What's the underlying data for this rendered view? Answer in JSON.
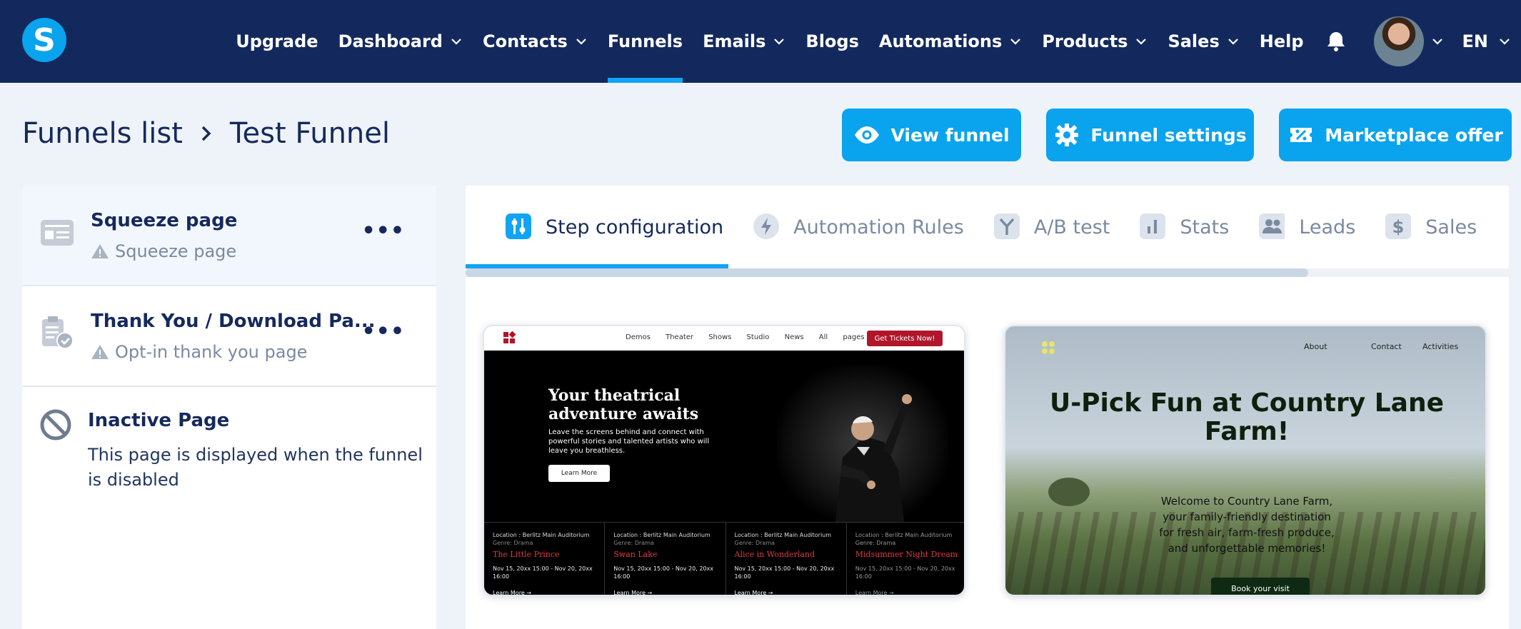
{
  "nav": {
    "logo_letter": "S",
    "items": [
      {
        "label": "Upgrade"
      },
      {
        "label": "Dashboard"
      },
      {
        "label": "Contacts"
      },
      {
        "label": "Funnels"
      },
      {
        "label": "Emails"
      },
      {
        "label": "Blogs"
      },
      {
        "label": "Automations"
      },
      {
        "label": "Products"
      },
      {
        "label": "Sales"
      },
      {
        "label": "Help"
      }
    ],
    "active": "Funnels",
    "language": "EN"
  },
  "breadcrumb": {
    "parent": "Funnels list",
    "current": "Test Funnel"
  },
  "actions": {
    "view_funnel": "View funnel",
    "funnel_settings": "Funnel settings",
    "marketplace_offer": "Marketplace offer"
  },
  "steps": [
    {
      "title": "Squeeze page",
      "subtitle": "Squeeze page",
      "icon": "page-layout-icon"
    },
    {
      "title": "Thank You / Download Pa...",
      "subtitle": "Opt-in thank you page",
      "icon": "clipboard-check-icon"
    }
  ],
  "inactive_page": {
    "title": "Inactive Page",
    "description": "This page is displayed when the funnel is disabled"
  },
  "tabs": [
    {
      "label": "Step configuration",
      "icon": "sliders-icon"
    },
    {
      "label": "Automation Rules",
      "icon": "lightning-icon"
    },
    {
      "label": "A/B test",
      "icon": "split-icon"
    },
    {
      "label": "Stats",
      "icon": "bar-chart-icon"
    },
    {
      "label": "Leads",
      "icon": "users-icon"
    },
    {
      "label": "Sales",
      "icon": "dollar-icon"
    }
  ],
  "templates": {
    "theater": {
      "menu": "Demos Theater Shows Studio News All pages",
      "cta": "Get Tickets Now!",
      "heading": "Your theatrical adventure awaits",
      "text": "Leave the screens behind and connect with powerful stories and talented artists who will leave you breathless.",
      "button": "Learn More",
      "shows": [
        {
          "location": "Location : Berlitz Main Auditorium",
          "genre": "Genre: Drama",
          "title": "The Little Prince",
          "dates": "Nov 15, 20xx 15:00 - Nov 20, 20xx 16:00",
          "link": "Learn More →"
        },
        {
          "location": "Location : Berlitz Main Auditorium",
          "genre": "Genre: Drama",
          "title": "Swan Lake",
          "dates": "Nov 15, 20xx 15:00 - Nov 20, 20xx 16:00",
          "link": "Learn More →"
        },
        {
          "location": "Location : Berlitz Main Auditorium",
          "genre": "Genre: Drama",
          "title": "Alice in Wonderland",
          "dates": "Nov 15, 20xx 15:00 - Nov 20, 20xx 16:00",
          "link": "Learn More →"
        },
        {
          "location": "Location : Berlitz Main Auditorium",
          "genre": "Genre: Drama",
          "title": "Midsummer Night Dream",
          "dates": "Nov 15, 20xx 15:00 - Nov 20, 20xx 16:00",
          "link": "Learn More →"
        }
      ]
    },
    "farm": {
      "menu": [
        "About",
        "Contact",
        "Activities"
      ],
      "heading": "U-Pick Fun at Country Lane Farm!",
      "text": "Welcome to Country Lane Farm, your family-friendly destination for fresh air, farm-fresh produce, and unforgettable memories!",
      "button": "Book your visit"
    }
  },
  "colors": {
    "nav_bg": "#13295e",
    "accent": "#0aa3ee",
    "text_dark": "#15295c",
    "text_muted": "#7a8aa0"
  }
}
